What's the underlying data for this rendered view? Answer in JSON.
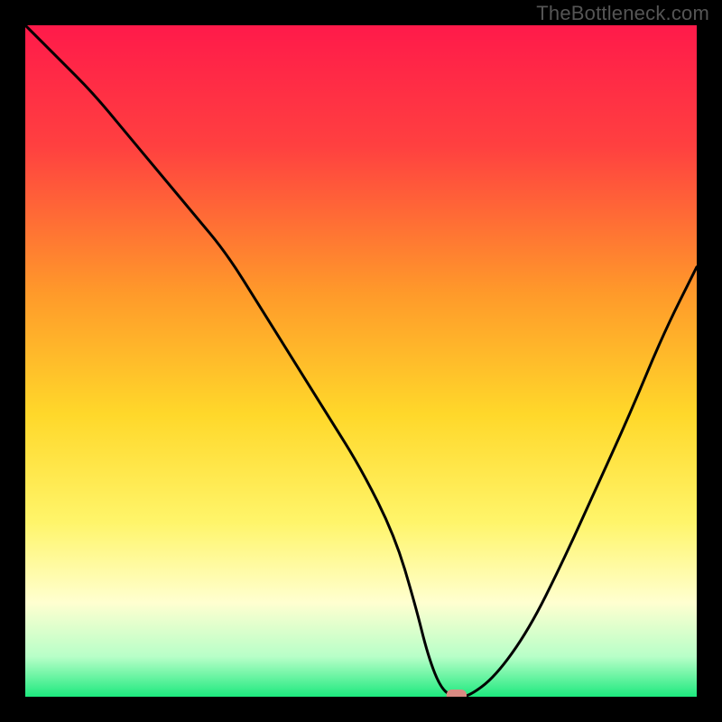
{
  "watermark": "TheBottleneck.com",
  "chart_data": {
    "type": "line",
    "title": "",
    "xlabel": "",
    "ylabel": "",
    "xlim": [
      0,
      100
    ],
    "ylim": [
      0,
      100
    ],
    "grid": false,
    "legend": false,
    "x": [
      0,
      5,
      10,
      15,
      20,
      25,
      30,
      35,
      40,
      45,
      50,
      55,
      58,
      60,
      62,
      64,
      66,
      70,
      75,
      80,
      85,
      90,
      95,
      100
    ],
    "values": [
      100,
      95,
      90,
      84,
      78,
      72,
      66,
      58,
      50,
      42,
      34,
      24,
      14,
      6,
      1,
      0,
      0,
      3,
      10,
      20,
      31,
      42,
      54,
      64
    ],
    "notch": {
      "x_start": 63,
      "x_end": 66,
      "y": 0
    },
    "background_gradient": {
      "type": "vertical",
      "stops": [
        {
          "pct": 0,
          "color": "#ff1a4a"
        },
        {
          "pct": 18,
          "color": "#ff4040"
        },
        {
          "pct": 40,
          "color": "#ff9a2a"
        },
        {
          "pct": 58,
          "color": "#ffd82a"
        },
        {
          "pct": 74,
          "color": "#fff56a"
        },
        {
          "pct": 86,
          "color": "#ffffd0"
        },
        {
          "pct": 94,
          "color": "#b8ffc8"
        },
        {
          "pct": 100,
          "color": "#1de97e"
        }
      ]
    }
  }
}
